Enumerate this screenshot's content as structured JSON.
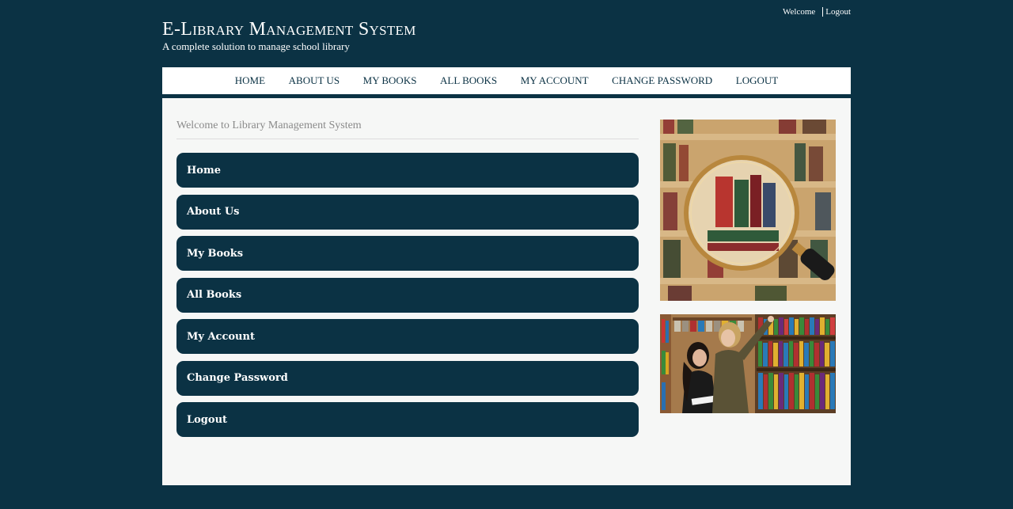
{
  "header": {
    "title": "E-Library Management System",
    "subtitle": "A complete solution to manage school library",
    "top_links": {
      "welcome": "Welcome",
      "logout": "Logout"
    }
  },
  "nav": {
    "items": [
      "HOME",
      "ABOUT US",
      "MY BOOKS",
      "ALL BOOKS",
      "MY ACCOUNT",
      "CHANGE PASSWORD",
      "LOGOUT"
    ]
  },
  "main": {
    "welcome_text": "Welcome to Library Management System",
    "menu": [
      "Home",
      "About Us",
      "My Books",
      "All Books",
      "My Account",
      "Change Password",
      "Logout"
    ]
  },
  "colors": {
    "background": "#0b3244",
    "panel": "#f6f7f6",
    "button": "#0b3244",
    "nav_text": "#0b3244"
  },
  "images": {
    "first": "magnifying-glass-over-bookshelf",
    "second": "students-browsing-library-shelves"
  }
}
